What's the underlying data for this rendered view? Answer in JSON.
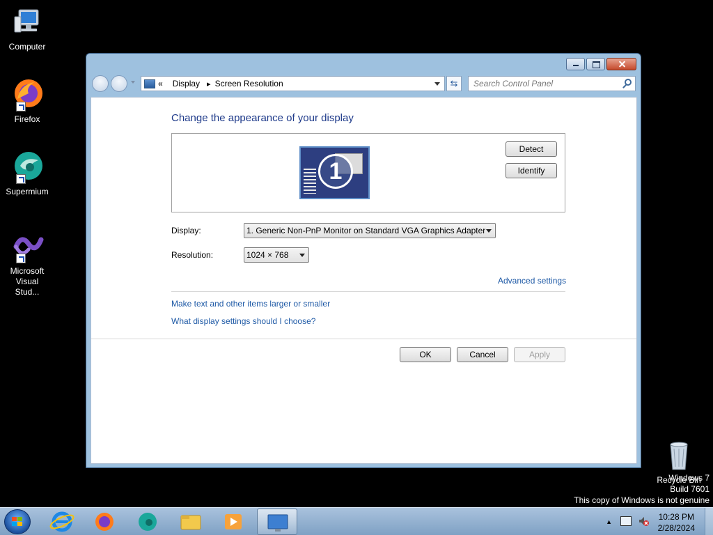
{
  "desktop": {
    "icons": [
      {
        "label": "Computer",
        "icon": "computer-icon"
      },
      {
        "label": "Firefox",
        "icon": "firefox-icon"
      },
      {
        "label": "Supermium",
        "icon": "supermium-icon"
      },
      {
        "label": "Microsoft Visual Stud...",
        "icon": "visual-studio-icon"
      },
      {
        "label": "Recycle Bin",
        "icon": "recycle-bin-icon"
      }
    ],
    "watermark": {
      "line1": "Windows 7",
      "line2": "Build 7601",
      "line3": "This copy of Windows is not genuine"
    }
  },
  "window": {
    "breadcrumb": {
      "chevron": "«",
      "items": [
        "Display",
        "Screen Resolution"
      ]
    },
    "search": {
      "placeholder": "Search Control Panel"
    },
    "heading": "Change the appearance of your display",
    "monitor_number": "1",
    "detect_label": "Detect",
    "identify_label": "Identify",
    "display_label": "Display:",
    "display_value": "1. Generic Non-PnP Monitor on Standard VGA Graphics Adapter",
    "resolution_label": "Resolution:",
    "resolution_value": "1024 × 768",
    "advanced_link": "Advanced settings",
    "text_size_link": "Make text and other items larger or smaller",
    "help_link": "What display settings should I choose?",
    "ok_label": "OK",
    "cancel_label": "Cancel",
    "apply_label": "Apply"
  },
  "taskbar": {
    "pinned": [
      "internet-explorer-icon",
      "firefox-icon",
      "supermium-icon",
      "explorer-icon",
      "media-player-icon",
      "display-settings-icon"
    ],
    "time": "10:28 PM",
    "date": "2/28/2024"
  },
  "colors": {
    "heading": "#1e3a8a",
    "link": "#1f5aa6",
    "frame": "#9ec1df",
    "taskbar": "#8fb0d2"
  }
}
